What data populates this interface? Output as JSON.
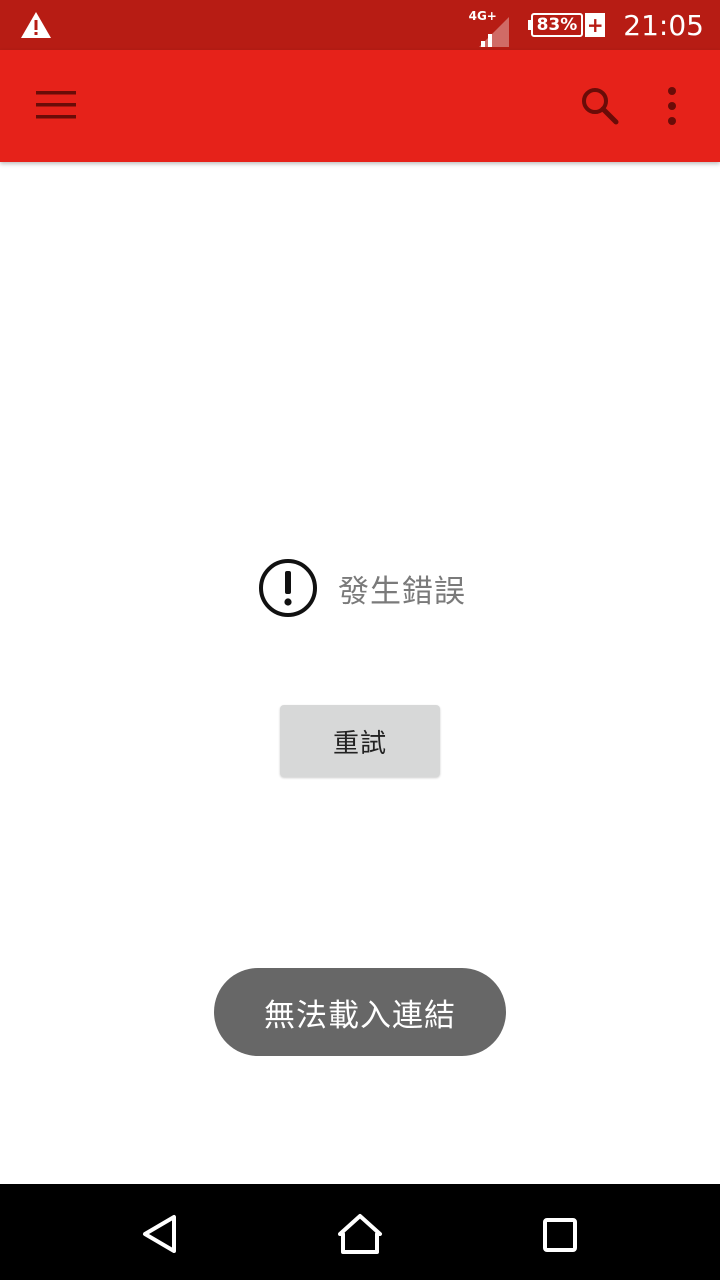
{
  "status_bar": {
    "network_label": "4G+",
    "battery_percent": "83%",
    "charging_symbol": "+",
    "time": "21:05",
    "color": "#b71c14",
    "icons": [
      "warning-icon",
      "signal-icon",
      "battery-icon"
    ]
  },
  "app_bar": {
    "color": "#e6221a",
    "icons": [
      "menu-icon",
      "search-icon",
      "more-vert-icon"
    ]
  },
  "content": {
    "error_icon": "error-circle-icon",
    "error_message": "發生錯誤",
    "retry_label": "重試"
  },
  "toast": {
    "message": "無法載入連結"
  },
  "nav_bar": {
    "icons": [
      "back-icon",
      "home-icon",
      "recents-icon"
    ]
  }
}
